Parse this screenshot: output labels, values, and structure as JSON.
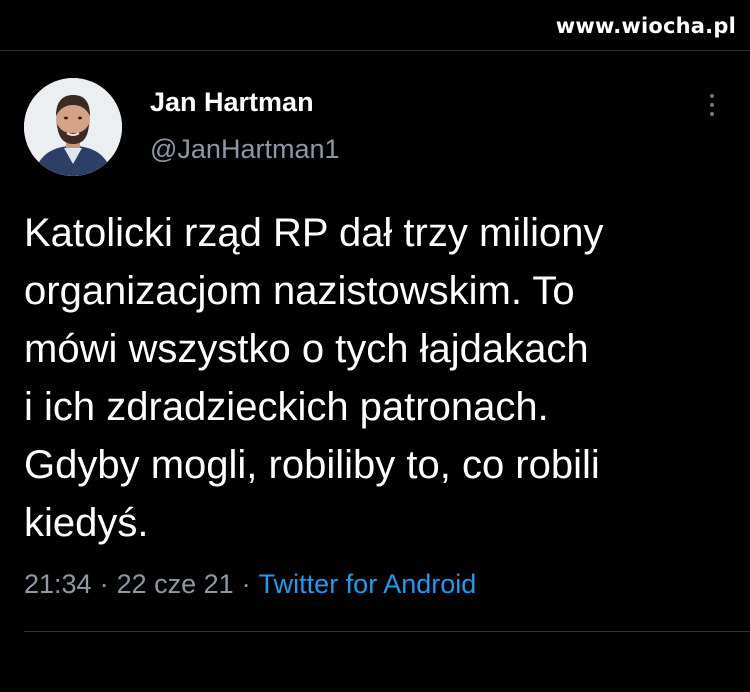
{
  "watermark": "www.wiocha.pl",
  "tweet": {
    "author": {
      "display_name": "Jan Hartman",
      "handle": "@JanHartman1"
    },
    "text": "Katolicki rząd RP dał trzy miliony\norganizacjom nazistowskim. To\nmówi wszystko o tych łajdakach\ni ich zdradzieckich patronach.\nGdyby mogli, robiliby to, co robili\nkiedyś.",
    "time": "21:34",
    "date": "22 cze 21",
    "separator": "·",
    "source": "Twitter for Android"
  },
  "colors": {
    "background": "#000000",
    "text": "#ffffff",
    "secondary_text": "#8b98a5",
    "link": "#1d9bf0",
    "divider": "#2f3336"
  }
}
